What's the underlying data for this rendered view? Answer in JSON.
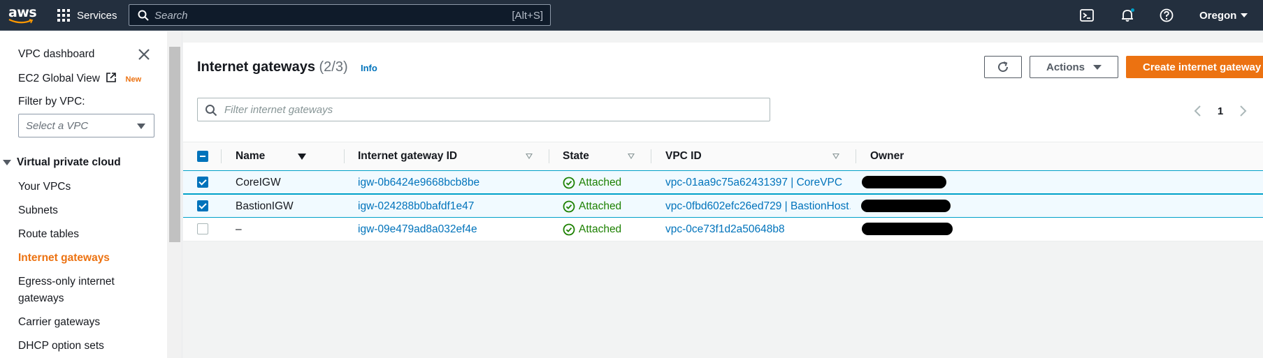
{
  "topbar": {
    "logo_text": "aws",
    "services_label": "Services",
    "search_placeholder": "Search",
    "search_shortcut": "[Alt+S]",
    "region": "Oregon"
  },
  "sidebar": {
    "dashboard": "VPC dashboard",
    "global_view": "EC2 Global View",
    "new_badge": "New",
    "filter_label": "Filter by VPC:",
    "filter_placeholder": "Select a VPC",
    "section": "Virtual private cloud",
    "items": [
      {
        "label": "Your VPCs",
        "active": false
      },
      {
        "label": "Subnets",
        "active": false
      },
      {
        "label": "Route tables",
        "active": false
      },
      {
        "label": "Internet gateways",
        "active": true
      },
      {
        "label": "Egress-only internet",
        "active": false
      },
      {
        "label": "gateways",
        "active": false
      },
      {
        "label": "Carrier gateways",
        "active": false
      },
      {
        "label": "DHCP option sets",
        "active": false
      }
    ]
  },
  "main": {
    "title": "Internet gateways",
    "count": "(2/3)",
    "info": "Info",
    "actions_label": "Actions",
    "create_label": "Create internet gateway",
    "filter_placeholder": "Filter internet gateways",
    "page": "1",
    "columns": [
      "Name",
      "Internet gateway ID",
      "State",
      "VPC ID",
      "Owner"
    ],
    "rows": [
      {
        "selected": true,
        "name": "CoreIGW",
        "id": "igw-0b6424e9668bcb8be",
        "state": "Attached",
        "vpc": "vpc-01aa9c75a62431397 | CoreVPC"
      },
      {
        "selected": true,
        "name": "BastionIGW",
        "id": "igw-024288b0bafdf1e47",
        "state": "Attached",
        "vpc": "vpc-0fbd602efc26ed729 | BastionHost…"
      },
      {
        "selected": false,
        "name": "–",
        "id": "igw-09e479ad8a032ef4e",
        "state": "Attached",
        "vpc": "vpc-0ce73f1d2a50648b8"
      }
    ]
  },
  "colors": {
    "topbar": "#232f3e",
    "accent_orange": "#ec7211",
    "link_blue": "#0073bb",
    "success_green": "#1d8102"
  }
}
